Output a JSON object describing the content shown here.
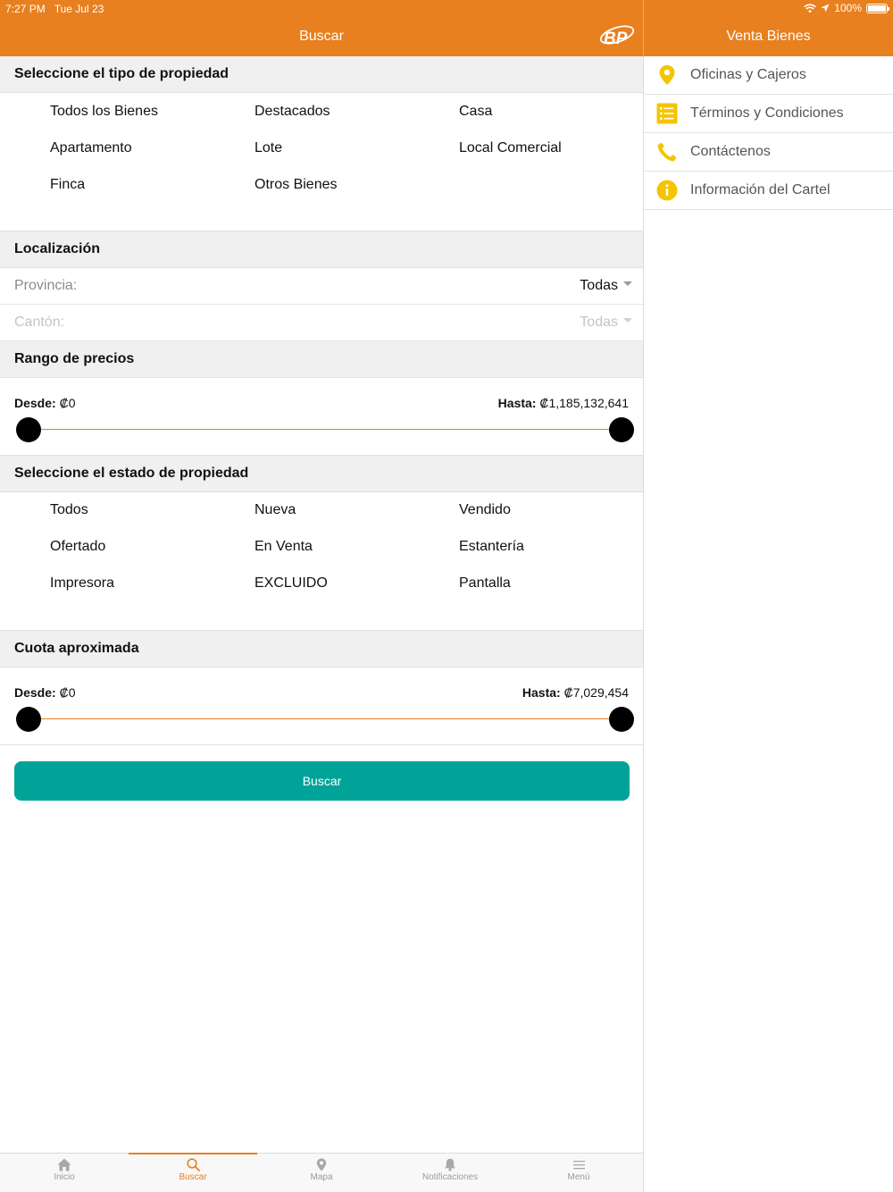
{
  "status": {
    "time": "7:27 PM",
    "date": "Tue Jul 23",
    "battery": "100%"
  },
  "nav": {
    "main_title": "Buscar",
    "side_title": "Venta Bienes"
  },
  "colors": {
    "brand_orange": "#E8801F",
    "button_teal": "#00A397",
    "icon_yellow": "#F5C400"
  },
  "property_type": {
    "header": "Seleccione el tipo de propiedad",
    "options": [
      "Todos los Bienes",
      "Destacados",
      "Casa",
      "Apartamento",
      "Lote",
      "Local Comercial",
      "Finca",
      "Otros Bienes"
    ]
  },
  "location": {
    "header": "Localización",
    "province_label": "Provincia:",
    "province_value": "Todas",
    "canton_label": "Cantón:",
    "canton_value": "Todas"
  },
  "price_range": {
    "header": "Rango de precios",
    "from_label": "Desde:",
    "from_value": "₡0",
    "to_label": "Hasta:",
    "to_value": "₡1,185,132,641"
  },
  "property_state": {
    "header": "Seleccione el estado de propiedad",
    "options": [
      "Todos",
      "Nueva",
      "Vendido",
      "Ofertado",
      "En Venta",
      "Estantería",
      "Impresora",
      "EXCLUIDO",
      "Pantalla"
    ]
  },
  "fee_range": {
    "header": "Cuota aproximada",
    "from_label": "Desde:",
    "from_value": "₡0",
    "to_label": "Hasta:",
    "to_value": "₡7,029,454"
  },
  "search_button": "Buscar",
  "side_menu": [
    {
      "icon": "location-pin-icon",
      "label": "Oficinas y Cajeros"
    },
    {
      "icon": "list-icon",
      "label": "Términos y Condiciones"
    },
    {
      "icon": "phone-icon",
      "label": "Contáctenos"
    },
    {
      "icon": "info-icon",
      "label": "Información del Cartel"
    }
  ],
  "tabs": [
    {
      "icon": "home-icon",
      "label": "Inicio"
    },
    {
      "icon": "search-icon",
      "label": "Buscar",
      "active": true
    },
    {
      "icon": "map-pin-icon",
      "label": "Mapa"
    },
    {
      "icon": "bell-icon",
      "label": "Notificaciones"
    },
    {
      "icon": "menu-icon",
      "label": "Menú"
    }
  ]
}
